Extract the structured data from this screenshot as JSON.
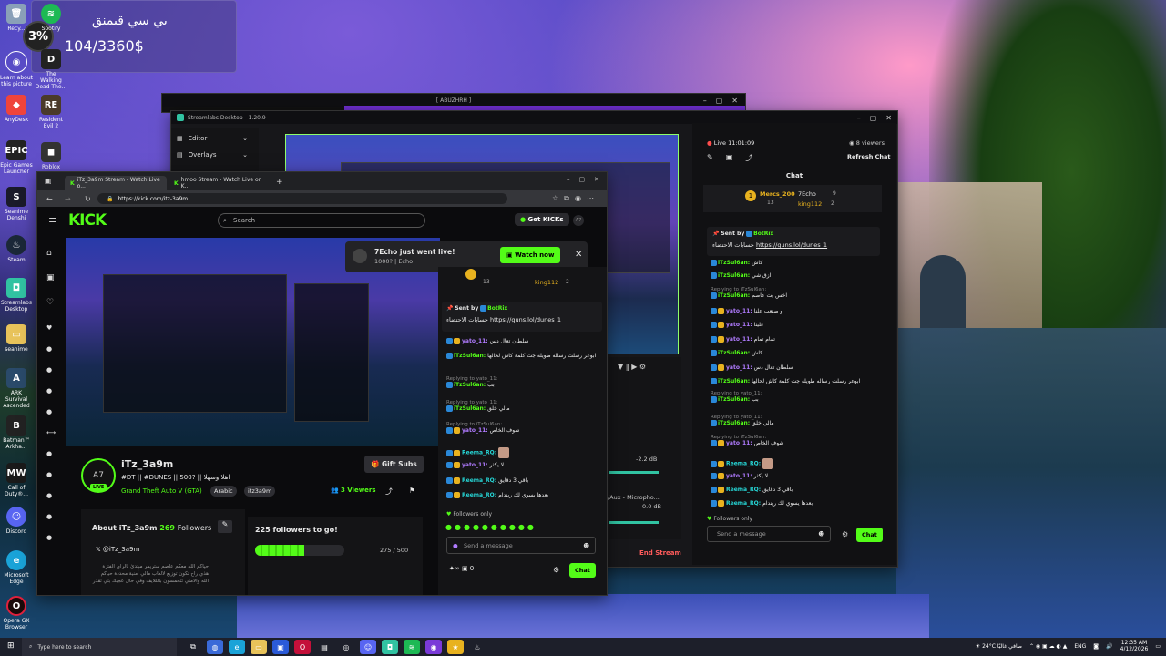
{
  "desktop": {
    "widget": {
      "percent": "3%",
      "title": "بي سي قيمنق",
      "progress_text": "104/3360$"
    },
    "icons": [
      {
        "label": "Recy..."
      },
      {
        "label": "Spotify"
      },
      {
        "label": "Learn about this picture"
      },
      {
        "label": "The Walking Dead The..."
      },
      {
        "label": "AnyDesk"
      },
      {
        "label": "Resident Evil 2"
      },
      {
        "label": "Epic Games Launcher"
      },
      {
        "label": "Roblox"
      },
      {
        "label": "Seanime Denshi"
      },
      {
        "label": "Steam"
      },
      {
        "label": "Streamlabs Desktop"
      },
      {
        "label": "seanime"
      },
      {
        "label": "ARK Survival Ascended"
      },
      {
        "label": "Batman™ Arkha..."
      },
      {
        "label": "Call of Duty®..."
      },
      {
        "label": "Discord"
      },
      {
        "label": "Microsoft Edge"
      },
      {
        "label": "Opera GX Browser"
      }
    ]
  },
  "streamlabs": {
    "outer_title": "[ ABUZHRH ]",
    "title": "Streamlabs Desktop - 1.20.9",
    "menu": [
      "Editor",
      "Overlays"
    ],
    "live_time": "Live 11:01:09",
    "viewers": "8 viewers",
    "refresh_chat": "Refresh Chat",
    "chat_title": "Chat",
    "leaders": [
      {
        "name": "Mercs_200",
        "count": "13"
      },
      {
        "name": "7Echo",
        "count": "9"
      },
      {
        "name": "king112",
        "count": "2"
      }
    ],
    "pinned": {
      "sent_by": "Sent by",
      "bot": "BotRix",
      "text": "حسابات الاحتضاء",
      "link": "https://guns.lol/dunes_1"
    },
    "messages": [
      {
        "name": "iTzSul6an:",
        "text": "كاش",
        "reply": ""
      },
      {
        "name": "iTzSul6an:",
        "text": "ازق شي",
        "reply": ""
      },
      {
        "name": "iTzSul6an:",
        "text": "اخس بت عاصم",
        "reply": "Replying to iTzSul6an:"
      },
      {
        "name": "yato_11:",
        "text": "و صنعب علنا",
        "reply": ""
      },
      {
        "name": "yato_11:",
        "text": "علينا",
        "reply": ""
      },
      {
        "name": "yato_11:",
        "text": "تمام تمام",
        "reply": ""
      },
      {
        "name": "iTzSul6an:",
        "text": "كاش",
        "reply": ""
      },
      {
        "name": "yato_11:",
        "text": "سلطان تعال دس",
        "reply": ""
      },
      {
        "name": "iTzSul6an:",
        "text": "ابوعر رسلت رساله طويله جت كلمة كاش لحالها",
        "reply": ""
      },
      {
        "name": "iTzSul6an:",
        "text": "بب",
        "reply": "Replying to yato_11:"
      },
      {
        "name": "iTzSul6an:",
        "text": "مالي خلق",
        "reply": "Replying to yato_11:"
      },
      {
        "name": "yato_11:",
        "text": "شوف الخاص",
        "reply": "Replying to iTzSul6an:"
      },
      {
        "name": "Reema_RQ:",
        "text": "",
        "reply": ""
      },
      {
        "name": "yato_11:",
        "text": "لا يكثر",
        "reply": ""
      },
      {
        "name": "Reema_RQ:",
        "text": "باقي 3 دقايق",
        "reply": ""
      },
      {
        "name": "Reema_RQ:",
        "text": "بعدها يسوي لك ريندام",
        "reply": ""
      }
    ],
    "followers_only": "Followers only",
    "send_placeholder": "Send a message",
    "chat_button": "Chat",
    "end_stream": "End Stream",
    "mixer": [
      {
        "label": "",
        "db": "-2.2 dB"
      },
      {
        "label": "Mic/Aux - Micropho...",
        "db": "0.0 dB"
      }
    ]
  },
  "browser": {
    "tabs": [
      {
        "title": "iTz_3a9m Stream - Watch Live o..."
      },
      {
        "title": "hmoo Stream - Watch Live on K..."
      }
    ],
    "url": "https://kick.com/itz-3a9m",
    "search_placeholder": "Search",
    "get_kicks": "Get KICKs",
    "notification": {
      "title": "7Echo just went live!",
      "subtitle": "1000? | Echo",
      "button": "Watch now"
    },
    "streamer": {
      "name": "iTz_3a9m",
      "tags_line": "#DT || #DUNES || 500? || اهلا وسهلا",
      "game": "Grand Theft Auto V (GTA)",
      "tags": [
        "Arabic",
        "itz3a9m"
      ],
      "viewers": "3 Viewers",
      "gift_subs": "Gift Subs",
      "live": "LIVE"
    },
    "about": {
      "title": "About iTz_3a9m",
      "followers": "269",
      "followers_label": "Followers",
      "x_handle": "@iTz_3a9m",
      "bio": "حياكم الله معكم عاصم ستريمر مبتدئ بالراي الفترة هذي راح تكون توزيع لالعاب مالي أمنية محددة حياكم الله والامني تتحمسون بالللايف وفي حال عجبك بثي تقدر تسوي فولو"
    },
    "goal": {
      "title": "225 followers to go!",
      "value": "275 / 500",
      "progress": 0.55
    },
    "chat": {
      "leaders": [
        {
          "name": "13"
        },
        {
          "name": "king112",
          "count": "2"
        }
      ],
      "pinned": {
        "sent_by": "Sent by",
        "bot": "BotRix",
        "text": "حسابات الاحتضاء",
        "link": "https://guns.lol/dunes_1"
      },
      "messages": [
        {
          "name": "yato_11:",
          "text": "سلطان تعال دس",
          "reply": ""
        },
        {
          "name": "iTzSul6an:",
          "text": "ابوعر رسلت رساله طويله جت كلمة كاش لحالها",
          "reply": ""
        },
        {
          "name": "iTzSul6an:",
          "text": "بب",
          "reply": "Replying to yato_11:"
        },
        {
          "name": "iTzSul6an:",
          "text": "مالي خلق",
          "reply": "Replying to yato_11:"
        },
        {
          "name": "yato_11:",
          "text": "شوف الخاص",
          "reply": "Replying to iTzSul6an:"
        },
        {
          "name": "Reema_RQ:",
          "text": "",
          "reply": ""
        },
        {
          "name": "yato_11:",
          "text": "لا يكثر",
          "reply": ""
        },
        {
          "name": "Reema_RQ:",
          "text": "باقي 3 دقايق",
          "reply": ""
        },
        {
          "name": "Reema_RQ:",
          "text": "بعدها يسوي لك ريندام",
          "reply": ""
        }
      ],
      "followers_only": "Followers only",
      "send_placeholder": "Send a message",
      "kicks_count": "0",
      "chat_button": "Chat"
    }
  },
  "taskbar": {
    "search_placeholder": "Type here to search",
    "weather": "24°C",
    "weather_text": "صافي غالبًا",
    "lang": "ENG",
    "time": "12:35 AM",
    "date": "4/12/2026"
  },
  "colors": {
    "kick_green": "#53fc18",
    "streamlabs_purple": "#6f2fd0"
  }
}
